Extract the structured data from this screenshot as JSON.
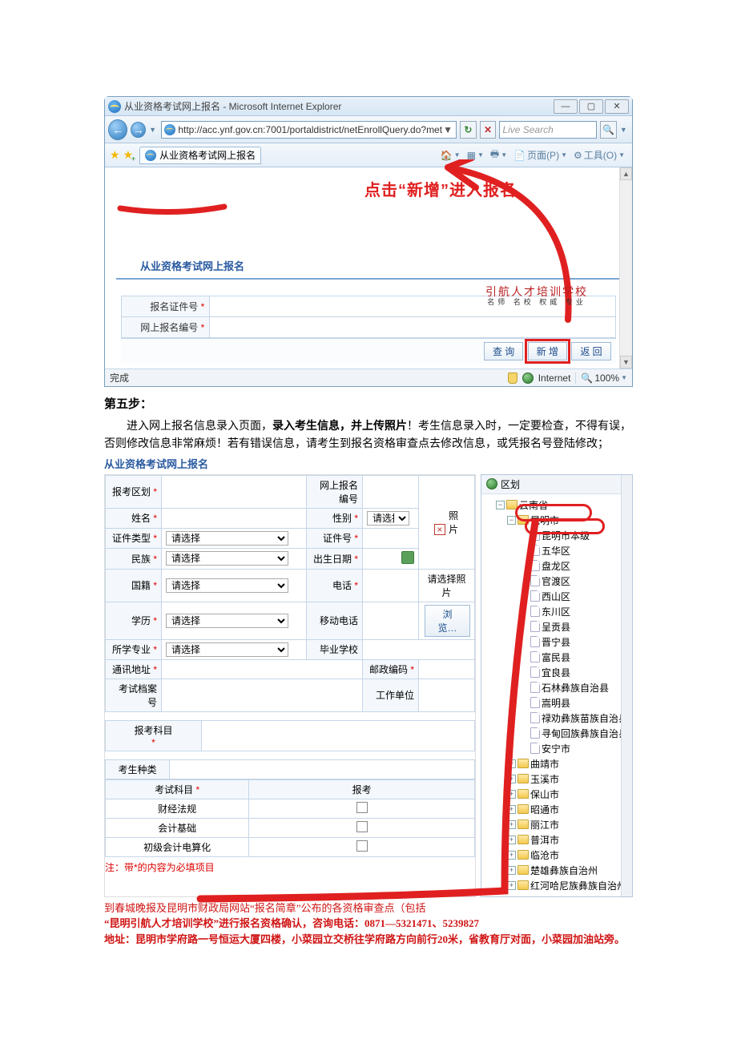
{
  "browser": {
    "title": "从业资格考试网上报名 - Microsoft Internet Explorer",
    "url": "http://acc.ynf.gov.cn:7001/portaldistrict/netEnrollQuery.do?met",
    "tab_title": "从业资格考试网上报名",
    "search_placeholder": "Live Search",
    "page_menu": "页面(P)",
    "tools_menu": "工具(O)",
    "win_min": "—",
    "win_max": "▢",
    "win_close": "✕",
    "status_done": "完成",
    "status_zone": "Internet",
    "status_zoom": "100%",
    "buttons": {
      "query": "查 询",
      "add": "新 增",
      "back": "返 回"
    }
  },
  "annot": {
    "click_add": "点击“新增”进入报名"
  },
  "page1": {
    "section_title": "从业资格考试网上报名",
    "field_idno": "报名证件号",
    "field_regno": "网上报名编号",
    "watermark_top": "引航人才培训学校",
    "watermark_sub": "名师 名校 权威 专业"
  },
  "doc": {
    "step5": "第五步：",
    "para": "进入网上报名信息录入页面，录入考生信息，并上传照片！考生信息录入时，一定要检查，不得有误，否则修改信息非常麻烦！若有错误信息，请考生到报名资格审查点去修改信息，或凭报名号登陆修改；",
    "bold_part": "录入考生信息，并上传照片"
  },
  "form2": {
    "title": "从业资格考试网上报名",
    "labels": {
      "region": "报考区划",
      "regno": "网上报名编号",
      "name": "姓名",
      "gender": "性别",
      "idtype": "证件类型",
      "idno": "证件号",
      "ethnic": "民族",
      "birth": "出生日期",
      "nation": "国籍",
      "phone": "电话",
      "edu": "学历",
      "mobile": "移动电话",
      "major": "所学专业",
      "school": "毕业学校",
      "addr": "通讯地址",
      "zip": "邮政编码",
      "archive": "考试档案号",
      "workunit": "工作单位",
      "subjects_applied": "报考科目",
      "candidate_type": "考生种类",
      "subject_col": "考试科目",
      "apply_col": "报考",
      "photo_label": "照片",
      "photo_hint": "请选择照片",
      "browse": "浏览…"
    },
    "select_placeholder": "请选择",
    "subjects": [
      "财经法规",
      "会计基础",
      "初级会计电算化"
    ],
    "note": "注：带*的内容为必填项目"
  },
  "tree": {
    "root": "区划",
    "items": [
      {
        "t": "云南省",
        "lvl": 1,
        "pm": "−",
        "icon": "folder"
      },
      {
        "t": "昆明市",
        "lvl": 2,
        "pm": "−",
        "icon": "folder"
      },
      {
        "t": "昆明市本级",
        "lvl": 3,
        "icon": "file",
        "hl": true
      },
      {
        "t": "五华区",
        "lvl": 3,
        "icon": "file"
      },
      {
        "t": "盘龙区",
        "lvl": 3,
        "icon": "file"
      },
      {
        "t": "官渡区",
        "lvl": 3,
        "icon": "file"
      },
      {
        "t": "西山区",
        "lvl": 3,
        "icon": "file"
      },
      {
        "t": "东川区",
        "lvl": 3,
        "icon": "file"
      },
      {
        "t": "呈贡县",
        "lvl": 3,
        "icon": "file"
      },
      {
        "t": "晋宁县",
        "lvl": 3,
        "icon": "file"
      },
      {
        "t": "富民县",
        "lvl": 3,
        "icon": "file"
      },
      {
        "t": "宜良县",
        "lvl": 3,
        "icon": "file"
      },
      {
        "t": "石林彝族自治县",
        "lvl": 3,
        "icon": "file"
      },
      {
        "t": "嵩明县",
        "lvl": 3,
        "icon": "file"
      },
      {
        "t": "禄劝彝族苗族自治县",
        "lvl": 3,
        "icon": "file"
      },
      {
        "t": "寻甸回族彝族自治县",
        "lvl": 3,
        "icon": "file"
      },
      {
        "t": "安宁市",
        "lvl": 3,
        "icon": "file"
      },
      {
        "t": "曲靖市",
        "lvl": 2,
        "pm": "+",
        "icon": "folder"
      },
      {
        "t": "玉溪市",
        "lvl": 2,
        "pm": "+",
        "icon": "folder"
      },
      {
        "t": "保山市",
        "lvl": 2,
        "pm": "+",
        "icon": "folder"
      },
      {
        "t": "昭通市",
        "lvl": 2,
        "pm": "+",
        "icon": "folder"
      },
      {
        "t": "丽江市",
        "lvl": 2,
        "pm": "+",
        "icon": "folder"
      },
      {
        "t": "普洱市",
        "lvl": 2,
        "pm": "+",
        "icon": "folder"
      },
      {
        "t": "临沧市",
        "lvl": 2,
        "pm": "+",
        "icon": "folder"
      },
      {
        "t": "楚雄彝族自治州",
        "lvl": 2,
        "pm": "+",
        "icon": "folder"
      },
      {
        "t": "红河哈尼族彝族自治州",
        "lvl": 2,
        "pm": "+",
        "icon": "folder"
      }
    ]
  },
  "redfooter": {
    "line1_a": "到春城晚报及昆明市财政局网站“报名简章”公布的各资格审查点（包括",
    "line2_a": "“昆明引航人才培训学校”进行报名资格确认，咨询电话：0871—5321471、5239827",
    "line3": "地址：昆明市学府路一号恒运大厦四楼，小菜园立交桥往学府路方向前行20米，省教育厅对面，小菜园加油站旁。"
  }
}
